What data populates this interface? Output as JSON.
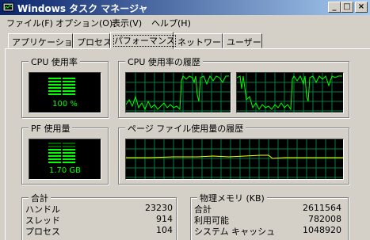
{
  "window": {
    "title": "Windows タスク マネージャ",
    "min_glyph": "_",
    "max_glyph": "□",
    "close_glyph": "×"
  },
  "menu": [
    "ファイル(F)",
    "オプション(O)",
    "表示(V)",
    "ヘルプ(H)"
  ],
  "tabs": [
    {
      "label": "アプリケーション",
      "active": false
    },
    {
      "label": "プロセス",
      "active": false
    },
    {
      "label": "パフォーマンス",
      "active": true
    },
    {
      "label": "ネットワーク",
      "active": false
    },
    {
      "label": "ユーザー",
      "active": false
    }
  ],
  "cpu_usage": {
    "legend": "CPU 使用率",
    "value_text": "100 %",
    "percent": 100
  },
  "cpu_history": {
    "legend": "CPU 使用率の履歴"
  },
  "pf_usage": {
    "legend": "PF 使用量",
    "value_text": "1.70 GB",
    "fill": 0.6
  },
  "pf_history": {
    "legend": "ページ ファイル使用量の履歴"
  },
  "totals": {
    "legend": "合計",
    "rows": [
      {
        "label": "ハンドル",
        "value": "23230"
      },
      {
        "label": "スレッド",
        "value": "914"
      },
      {
        "label": "プロセス",
        "value": "104"
      }
    ]
  },
  "physical_memory": {
    "legend": "物理メモリ (KB)",
    "rows": [
      {
        "label": "合計",
        "value": "2611564"
      },
      {
        "label": "利用可能",
        "value": "782008"
      },
      {
        "label": "システム キャッシュ",
        "value": "1048920"
      }
    ]
  },
  "colors": {
    "graph_bg": "#000000",
    "graph_grid": "#008040",
    "graph_line": "#00ff00",
    "pf_line": "#ffff00",
    "title_start": "#0a246a",
    "title_end": "#a6caf0"
  }
}
